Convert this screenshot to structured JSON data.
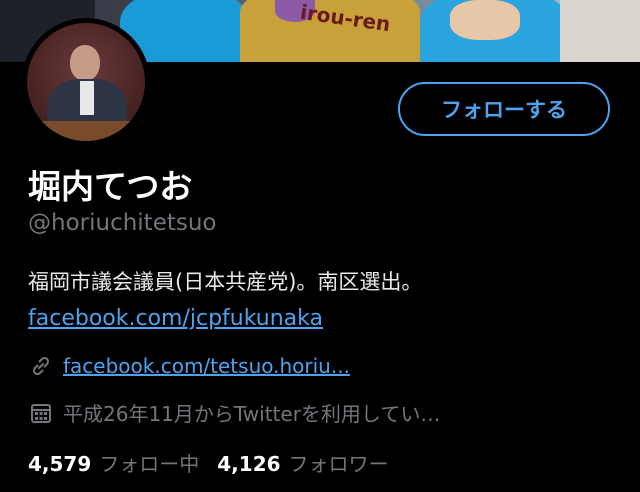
{
  "profile": {
    "display_name": "堀内てつお",
    "handle": "@horiuchitetsuo",
    "bio": "福岡市議会議員(日本共産党)。南区選出。",
    "bio_link": "facebook.com/jcpfukunaka",
    "website": "facebook.com/tetsuo.horiu...",
    "joined": "平成26年11月からTwitterを利用してい…",
    "follow_button": "フォローする",
    "banner_text": "irou-ren",
    "stats": {
      "following_count": "4,579",
      "following_label": "フォロー中",
      "followers_count": "4,126",
      "followers_label": "フォロワー"
    }
  },
  "colors": {
    "background": "#000000",
    "accent": "#4ea3ee",
    "text_primary": "#e7e9ea",
    "text_secondary": "#71767b"
  },
  "icons": {
    "website": "link-icon",
    "joined": "calendar-icon"
  }
}
